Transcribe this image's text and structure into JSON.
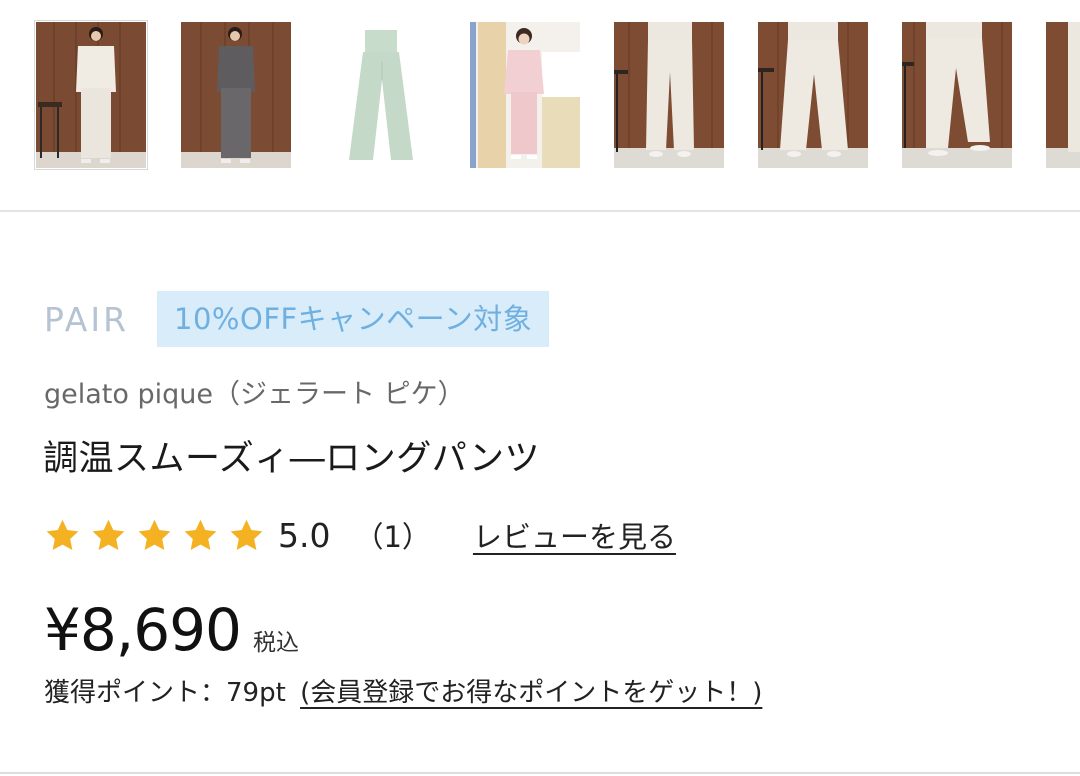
{
  "thumbnails": [
    {
      "name": "product-thumbnail-1",
      "variant": "cream-cardigan-set-on-model"
    },
    {
      "name": "product-thumbnail-2",
      "variant": "charcoal-set-on-model"
    },
    {
      "name": "product-thumbnail-3",
      "variant": "mint-pants-flat"
    },
    {
      "name": "product-thumbnail-4",
      "variant": "pink-set-on-model"
    },
    {
      "name": "product-thumbnail-5",
      "variant": "cream-pants-front"
    },
    {
      "name": "product-thumbnail-6",
      "variant": "cream-pants-back"
    },
    {
      "name": "product-thumbnail-7",
      "variant": "cream-pants-side"
    },
    {
      "name": "product-thumbnail-8",
      "variant": "cream-pants-partial"
    }
  ],
  "tags": {
    "pair": "PAIR",
    "campaign": "10%OFFキャンペーン対象"
  },
  "product": {
    "brand": "gelato pique（ジェラート ピケ）",
    "name": "調温スムーズィ―ロングパンツ"
  },
  "rating": {
    "stars": 5,
    "max_stars": 5,
    "score": "5.0",
    "count": "（1）",
    "review_link": "レビューを見る"
  },
  "price": {
    "amount": "¥8,690",
    "tax_label": "税込"
  },
  "points": {
    "label": "獲得ポイント：79pt",
    "link": "(会員登録でお得なポイントをゲット！)"
  },
  "colors": {
    "star": "#F4B223",
    "campaign_bg": "#D9ECFA",
    "campaign_text": "#6FB0E0",
    "pair_text": "#B5C3D3"
  }
}
